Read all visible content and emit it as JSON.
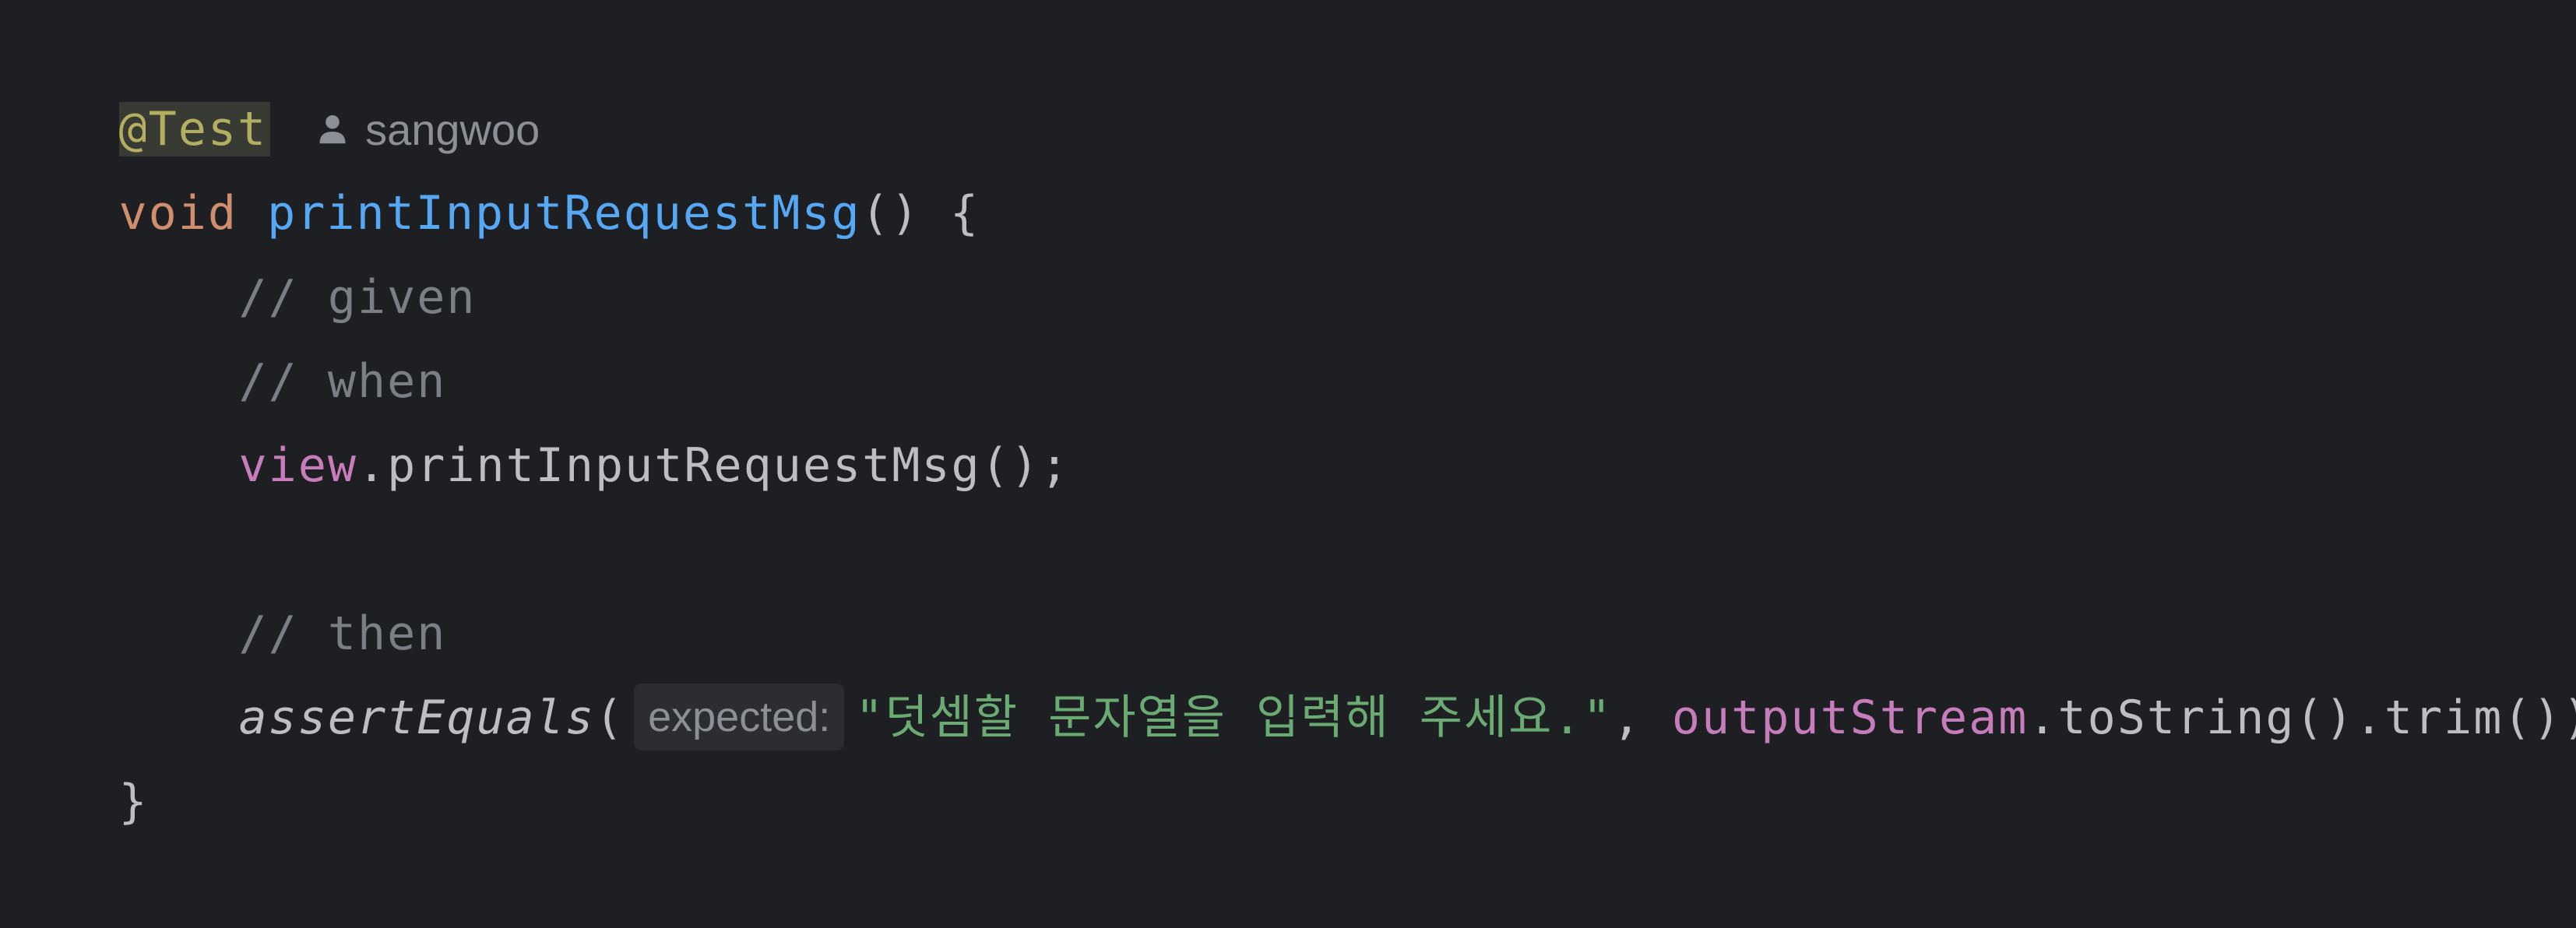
{
  "code": {
    "annotation": "@Test",
    "author": {
      "icon": "user-icon",
      "name": "sangwoo"
    },
    "method_signature": {
      "keyword": "void",
      "name": "printInputRequestMsg",
      "rest": "() {"
    },
    "comment_given": "// given",
    "comment_when": "// when",
    "call_line": {
      "receiver": "view",
      "call": ".printInputRequestMsg();"
    },
    "comment_then": "// then",
    "assert_line": {
      "method": "assertEquals",
      "open": "(",
      "hint_label": "expected:",
      "string_value": "\"덧셈할 문자열을 입력해 주세요.\"",
      "separator": ", ",
      "field": "outputStream",
      "tail": ".toString().trim());"
    },
    "closing_brace": "}"
  },
  "colors": {
    "background": "#1e1f22",
    "keyword": "#cf8e6d",
    "method_declaration": "#56a8f5",
    "comment": "#7a7e85",
    "field": "#c77dbb",
    "string": "#6aab73",
    "annotation": "#b3ae60"
  }
}
